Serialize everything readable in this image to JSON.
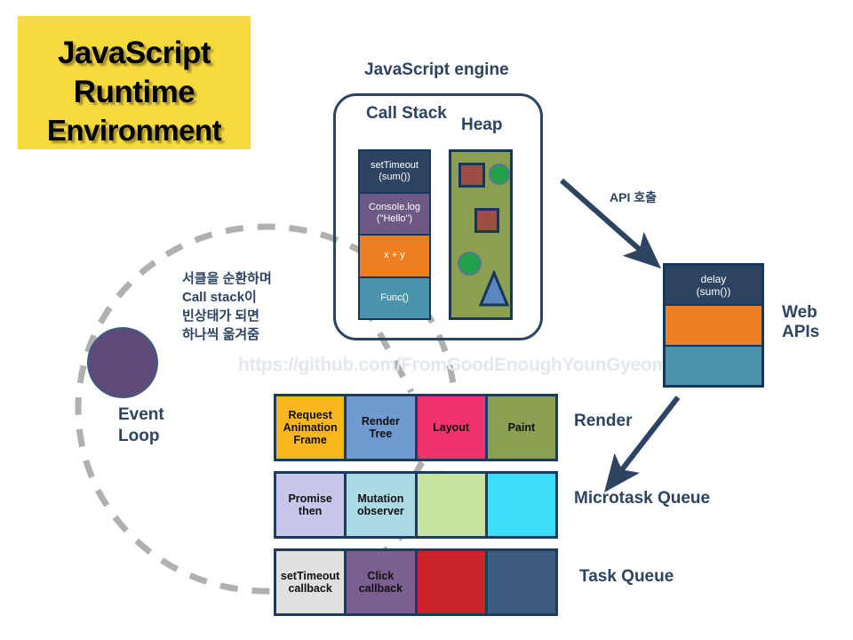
{
  "title": {
    "line1": "JavaScript",
    "line2": "Runtime",
    "line3": "Environment",
    "background_color": "#f7da3e",
    "text_color": "#000000"
  },
  "js_engine": {
    "title": "JavaScript engine",
    "call_stack": {
      "title": "Call\nStack",
      "frames": [
        {
          "label": "setTimeout\n(sum())",
          "color": "#2c4461"
        },
        {
          "label": "Console.log\n(\"Hello\")",
          "color": "#6d5a84"
        },
        {
          "label": "x + y",
          "color": "#ee8022"
        },
        {
          "label": "Func()",
          "color": "#4a94ab"
        }
      ]
    },
    "heap": {
      "title": "Heap",
      "background_color": "#8aa050",
      "objects": [
        {
          "shape": "square",
          "color": "#9c4f42"
        },
        {
          "shape": "circle",
          "color": "#21a24a"
        },
        {
          "shape": "square",
          "color": "#9c4f42"
        },
        {
          "shape": "circle",
          "color": "#21a24a"
        },
        {
          "shape": "triangle",
          "color": "#5a87bf"
        }
      ]
    }
  },
  "web_apis": {
    "label": "Web\nAPIs",
    "cells": [
      {
        "label": "delay\n(sum())",
        "color": "#2c4461"
      },
      {
        "label": "",
        "color": "#ee8022"
      },
      {
        "label": "",
        "color": "#4a94ab"
      }
    ]
  },
  "arrows": {
    "api_call_label": "API 호출",
    "render_label": "Render"
  },
  "queues": [
    {
      "name": "render",
      "label": "Render",
      "cells": [
        {
          "label": "Request\nAnimation\nFrame",
          "color": "#f9b61e"
        },
        {
          "label": "Render\nTree",
          "color": "#6f9bd1"
        },
        {
          "label": "Layout",
          "color": "#f0326f"
        },
        {
          "label": "Paint",
          "color": "#8aa050"
        }
      ]
    },
    {
      "name": "microtask",
      "label": "Microtask Queue",
      "cells": [
        {
          "label": "Promise\nthen",
          "color": "#c8c6ea"
        },
        {
          "label": "Mutation\nobserver",
          "color": "#aadbe4"
        },
        {
          "label": "",
          "color": "#c7e3a0"
        },
        {
          "label": "",
          "color": "#3ddcf7"
        }
      ]
    },
    {
      "name": "task",
      "label": "Task Queue",
      "cells": [
        {
          "label": "setTimeout\ncallback",
          "color": "#e0e0e0"
        },
        {
          "label": "Click\ncallback",
          "color": "#7a5f90"
        },
        {
          "label": "",
          "color": "#cc2229"
        },
        {
          "label": "",
          "color": "#3e5a7e"
        }
      ]
    }
  ],
  "event_loop": {
    "label": "Event\nLoop",
    "circle_color": "#5e4a79"
  },
  "annotation": {
    "korean_note": "서클을 순환하며\nCall stack이\n빈상태가 되면\n하나씩 옮겨줌"
  },
  "watermark": {
    "text": "https://github.com/FromGoodEnoughYounGyeom"
  },
  "colors": {
    "navy": "#2c4461",
    "border_navy": "#16365c",
    "dashed_gray": "#b0b0b0"
  }
}
